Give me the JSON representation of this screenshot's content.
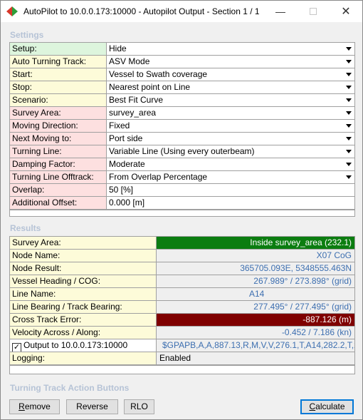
{
  "window": {
    "title": "AutoPilot to 10.0.0.173:10000 - Autopilot Output - Section 1 / 1",
    "minimize_icon": "minimize-icon",
    "maximize_icon": "maximize-icon",
    "close_icon": "close-icon"
  },
  "settings": {
    "title": "Settings",
    "rows": [
      {
        "label": "Setup:",
        "value": "Hide",
        "dropdown": true
      },
      {
        "label": "Auto Turning Track:",
        "value": "ASV Mode",
        "dropdown": true
      },
      {
        "label": "Start:",
        "value": "Vessel to Swath coverage",
        "dropdown": true
      },
      {
        "label": "Stop:",
        "value": "Nearest point on Line",
        "dropdown": true
      },
      {
        "label": "Scenario:",
        "value": "Best Fit Curve",
        "dropdown": true
      },
      {
        "label": "Survey Area:",
        "value": "survey_area",
        "dropdown": true
      },
      {
        "label": "Moving Direction:",
        "value": "Fixed",
        "dropdown": true
      },
      {
        "label": "Next Moving to:",
        "value": "Port side",
        "dropdown": true
      },
      {
        "label": "Turning Line:",
        "value": "Variable Line (Using every outerbeam)",
        "dropdown": true
      },
      {
        "label": "Damping Factor:",
        "value": "Moderate",
        "dropdown": true
      },
      {
        "label": "Turning Line Offtrack:",
        "value": "From Overlap Percentage",
        "dropdown": true
      },
      {
        "label": "Overlap:",
        "value": "50 [%]",
        "dropdown": false
      },
      {
        "label": "Additional Offset:",
        "value": "0.000 [m]",
        "dropdown": false
      }
    ]
  },
  "results": {
    "title": "Results",
    "rows": [
      {
        "label": "Survey Area:",
        "value": "Inside survey_area (232.1)"
      },
      {
        "label": "Node Name:",
        "value": "X07 CoG"
      },
      {
        "label": "Node Result:",
        "value": "365705.093E, 5348555.463N"
      },
      {
        "label": "Vessel Heading / COG:",
        "value": "267.989° / 273.898° (grid)"
      },
      {
        "label": "Line Name:",
        "value": "A14"
      },
      {
        "label": "Line Bearing / Track Bearing:",
        "value": "277.495° / 277.495° (grid)"
      },
      {
        "label": "Cross Track Error:",
        "value": "-887.126 (m)"
      },
      {
        "label": "Velocity Across / Along:",
        "value": "-0.452 / 7.186 (kn)"
      },
      {
        "label": "Output to 10.0.0.173:10000",
        "value": "$GPAPB,A,A,887.13,R,M,V,V,276.1,T,A14,282.2,T,28...",
        "checked": true
      },
      {
        "label": "Logging:",
        "value": "Enabled"
      }
    ]
  },
  "actions": {
    "title": "Turning Track Action Buttons",
    "remove_label": "Remove",
    "reverse_label": "Reverse",
    "rlo_label": "RLO",
    "calculate_label": "Calculate"
  },
  "colors": {
    "section_title": "#b6c3d6",
    "status_green": "#0b7d10",
    "status_red": "#7f0000",
    "value_blue": "#3d6fb0"
  }
}
